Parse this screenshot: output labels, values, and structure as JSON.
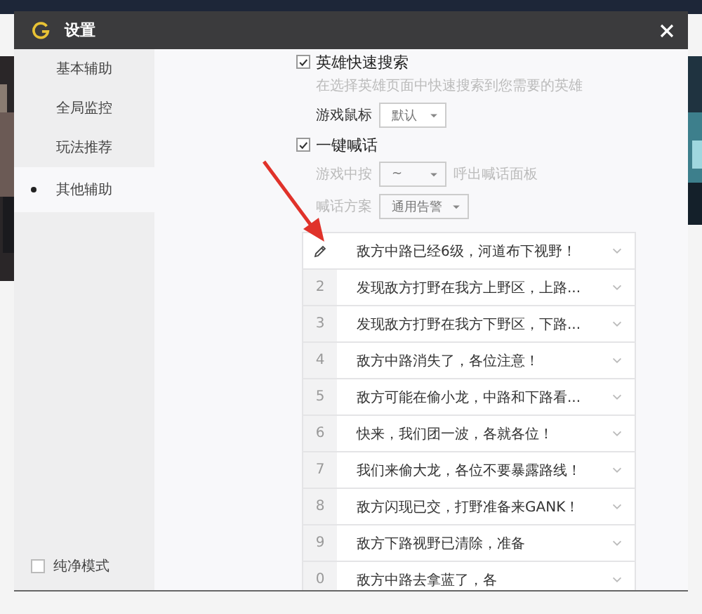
{
  "window": {
    "title": "设置"
  },
  "sidebar": {
    "items": [
      {
        "label": "基本辅助",
        "selected": false
      },
      {
        "label": "全局监控",
        "selected": false
      },
      {
        "label": "玩法推荐",
        "selected": false
      },
      {
        "label": "其他辅助",
        "selected": true
      }
    ],
    "pure_mode": {
      "label": "纯净模式",
      "checked": false
    }
  },
  "settings": [
    {
      "kind": "check",
      "label": "英雄快速搜索",
      "checked": true,
      "hint": "在选择英雄页面中快速搜索到您需要的英雄"
    },
    {
      "kind": "select",
      "label": "游戏鼠标",
      "value": "默认",
      "disabled": false
    },
    {
      "kind": "check",
      "label": "一键喊话",
      "checked": true
    },
    {
      "kind": "select",
      "label": "游戏中按",
      "value": "~",
      "suffix": "呼出喊话面板",
      "disabled": true
    },
    {
      "kind": "select",
      "label": "喊话方案",
      "value": "通用告警",
      "disabled": true
    }
  ],
  "phrases": [
    {
      "kind": "editing",
      "text": "敌方中路已经6级，河道布下视野！"
    },
    {
      "kind": "number",
      "key": "2",
      "text": "发现敌方打野在我方上野区，上路..."
    },
    {
      "kind": "number",
      "key": "3",
      "text": "发现敌方打野在我方下野区，下路..."
    },
    {
      "kind": "number",
      "key": "4",
      "text": "敌方中路消失了，各位注意！"
    },
    {
      "kind": "number",
      "key": "5",
      "text": "敌方可能在偷小龙，中路和下路看..."
    },
    {
      "kind": "number",
      "key": "6",
      "text": "快来，我们团一波，各就各位！"
    },
    {
      "kind": "number",
      "key": "7",
      "text": "我们来偷大龙，各位不要暴露路线！"
    },
    {
      "kind": "number",
      "key": "8",
      "text": "敌方闪现已交，打野准备来GANK！"
    },
    {
      "kind": "number",
      "key": "9",
      "text": "敌方下路视野已清除，准备"
    },
    {
      "kind": "number",
      "key": "0",
      "text": "敌方中路去拿蓝了，各"
    }
  ]
}
